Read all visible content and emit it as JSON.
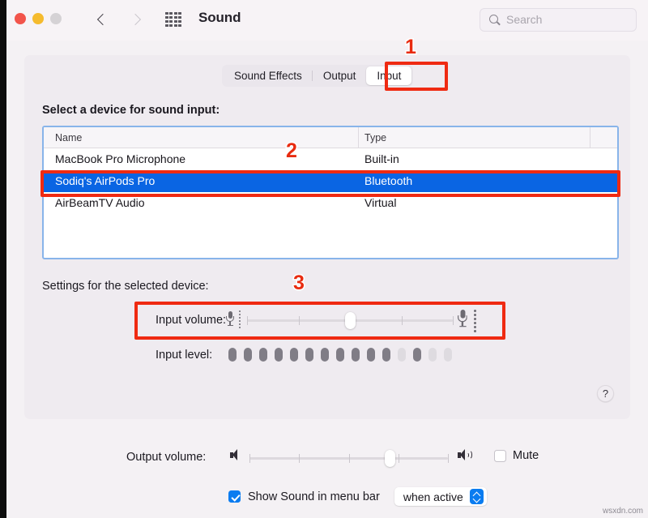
{
  "window": {
    "title": "Sound",
    "traffic_lights": [
      "close",
      "minimize",
      "zoom"
    ],
    "nav": {
      "back": "‹",
      "forward": "›"
    },
    "grid_icon": "show-all-grid-icon"
  },
  "search": {
    "placeholder": "Search",
    "icon": "search-icon"
  },
  "tabs": [
    {
      "label": "Sound Effects",
      "active": false
    },
    {
      "label": "Output",
      "active": false
    },
    {
      "label": "Input",
      "active": true
    }
  ],
  "device_section": {
    "label": "Select a device for sound input:",
    "columns": [
      "Name",
      "Type"
    ],
    "rows": [
      {
        "name": "MacBook Pro Microphone",
        "type": "Built-in",
        "selected": false
      },
      {
        "name": "Sodiq's AirPods Pro",
        "type": "Bluetooth",
        "selected": true
      },
      {
        "name": "AirBeamTV Audio",
        "type": "Virtual",
        "selected": false
      }
    ]
  },
  "settings_section": {
    "label": "Settings for the selected device:",
    "input_volume": {
      "label": "Input volume:",
      "value_percent": 50,
      "left_icon": "microphone-small-icon",
      "right_icon": "microphone-large-icon",
      "tick_positions": [
        0,
        25,
        50,
        75,
        100
      ]
    },
    "input_level": {
      "label": "Input level:",
      "segments": [
        "on",
        "on",
        "on",
        "on",
        "on",
        "on",
        "on",
        "on",
        "on",
        "on",
        "on",
        "off",
        "on",
        "off",
        "off"
      ]
    }
  },
  "help_button": {
    "label": "?",
    "icon": "help-question-icon"
  },
  "footer": {
    "output_volume": {
      "label": "Output volume:",
      "value_percent": 71,
      "left_icon": "speaker-low-icon",
      "right_icon": "speaker-high-icon",
      "tick_positions": [
        0,
        25,
        50,
        75,
        100
      ]
    },
    "mute": {
      "label": "Mute",
      "checked": false
    },
    "menu_bar": {
      "label": "Show Sound in menu bar",
      "checked": true,
      "popup_value": "when active",
      "popup_icon": "chevron-up-down-icon"
    }
  },
  "annotations": {
    "one": "1",
    "two": "2",
    "three": "3",
    "color": "#e82b10"
  },
  "watermark": "wsxdn.com",
  "colors": {
    "selection_blue": "#0a65e3",
    "accent_blue": "#0a7cf0",
    "focus_ring": "#88b4ea",
    "annotation_red": "#ef2a12",
    "window_bg": "#f4f1f4",
    "panel_bg": "#efebf0"
  }
}
